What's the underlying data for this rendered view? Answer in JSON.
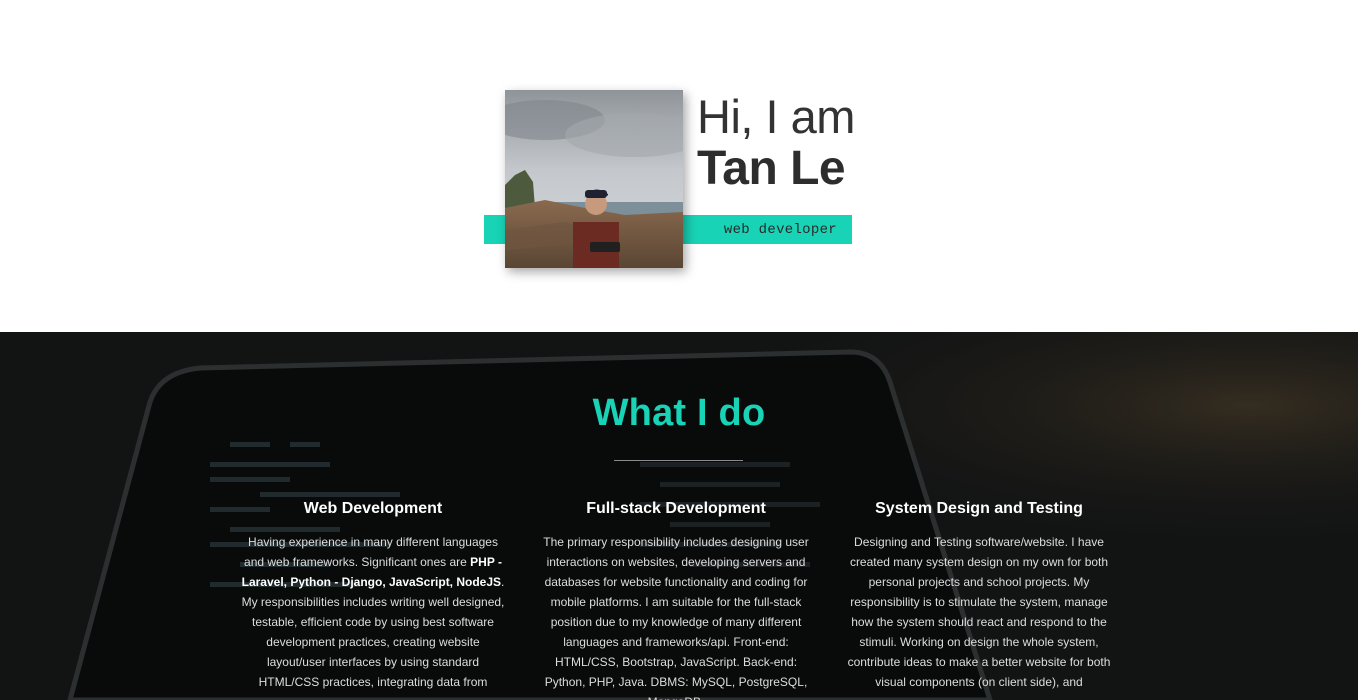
{
  "nav": {
    "menu_icon": "hamburger-menu-icon"
  },
  "hero": {
    "greeting": "Hi, I am",
    "name": "Tan Le",
    "role": "web developer",
    "photo_alt": "Tan Le photo",
    "accent_color": "#19d3b6"
  },
  "what_i_do": {
    "title": "What I do",
    "columns": [
      {
        "heading": "Web Development",
        "text_before": "Having experience in many different languages and web frameworks. Significant ones are ",
        "bold": "PHP - Laravel, Python - Django, JavaScript, NodeJS",
        "text_after": ". My responsibilities includes writing well designed, testable, efficient code by using best software development practices, creating website layout/user interfaces by using standard HTML/CSS practices, integrating data from"
      },
      {
        "heading": "Full-stack Development",
        "text": "The primary responsibility includes designing user interactions on websites, developing servers and databases for website functionality and coding for mobile platforms. I am suitable for the full-stack position due to my knowledge of many different languages and frameworks/api. Front-end: HTML/CSS, Bootstrap, JavaScript. Back-end: Python, PHP, Java. DBMS: MySQL, PostgreSQL, MongoDB."
      },
      {
        "heading": "System Design and Testing",
        "text": "Designing and Testing software/website. I have created many system design on my own for both personal projects and school projects. My responsibility is to stimulate the system, manage how the system should react and respond to the stimuli. Working on design the whole system, contribute ideas to make a better website for both visual components (on client side), and"
      }
    ]
  }
}
